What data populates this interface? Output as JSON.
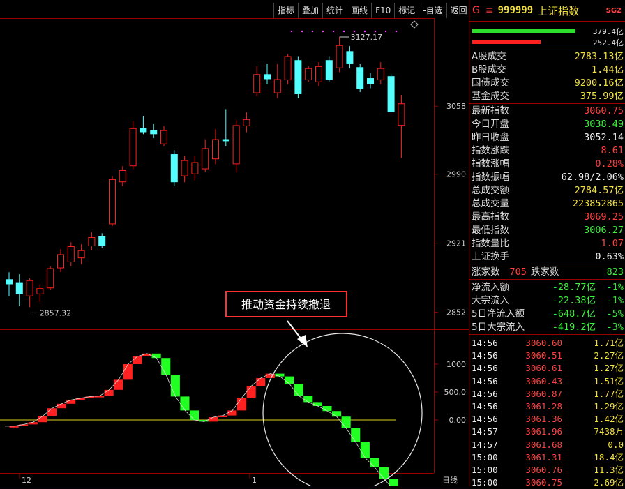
{
  "toolbar": [
    "指标",
    "叠加",
    "统计",
    "画线",
    "F10",
    "标记",
    "-自选",
    "返回"
  ],
  "header": {
    "prefix": "G",
    "menu_icon": "≡",
    "code": "999999",
    "name": "上证指数",
    "badge": "SG2"
  },
  "volume_bars": {
    "up_value": "379.4亿",
    "down_value": "252.4亿"
  },
  "stats1": [
    {
      "label": "A股成交",
      "value": "2783.13亿",
      "color": "yellow"
    },
    {
      "label": "B股成交",
      "value": "1.44亿",
      "color": "yellow"
    },
    {
      "label": "国债成交",
      "value": "9200.16亿",
      "color": "yellow"
    },
    {
      "label": "基金成交",
      "value": "375.99亿",
      "color": "yellow"
    }
  ],
  "stats2": [
    {
      "label": "最新指数",
      "value": "3060.75",
      "color": "red"
    },
    {
      "label": "今日开盘",
      "value": "3038.49",
      "color": "green"
    },
    {
      "label": "昨日收盘",
      "value": "3052.14",
      "color": "white"
    },
    {
      "label": "指数涨跌",
      "value": "8.61",
      "color": "red"
    },
    {
      "label": "指数涨幅",
      "value": "0.28%",
      "color": "red"
    },
    {
      "label": "指数振幅",
      "value": "62.98/2.06%",
      "color": "white"
    },
    {
      "label": "总成交额",
      "value": "2784.57亿",
      "color": "yellow"
    },
    {
      "label": "总成交量",
      "value": "223852865",
      "color": "yellow"
    },
    {
      "label": "最高指数",
      "value": "3069.25",
      "color": "red"
    },
    {
      "label": "最低指数",
      "value": "3006.27",
      "color": "green"
    },
    {
      "label": "指数量比",
      "value": "1.07",
      "color": "red"
    },
    {
      "label": "上证换手",
      "value": "0.63%",
      "color": "white"
    }
  ],
  "updown": {
    "up_label": "涨家数",
    "up_value": "705",
    "down_label": "跌家数",
    "down_value": "823"
  },
  "flows": [
    {
      "label": "净流入额",
      "value": "-28.77亿",
      "pct": "-1%"
    },
    {
      "label": "大宗流入",
      "value": "-22.38亿",
      "pct": "-1%"
    },
    {
      "label": "5日净流入额",
      "value": "-648.7亿",
      "pct": "-5%"
    },
    {
      "label": "5日大宗流入",
      "value": "-419.2亿",
      "pct": "-3%"
    }
  ],
  "ticks": [
    {
      "time": "14:56",
      "price": "3060.60",
      "vol": "1.71亿"
    },
    {
      "time": "14:56",
      "price": "3060.51",
      "vol": "2.27亿"
    },
    {
      "time": "14:56",
      "price": "3060.61",
      "vol": "1.27亿"
    },
    {
      "time": "14:56",
      "price": "3060.43",
      "vol": "1.51亿"
    },
    {
      "time": "14:56",
      "price": "3060.87",
      "vol": "1.77亿"
    },
    {
      "time": "14:56",
      "price": "3061.28",
      "vol": "1.29亿"
    },
    {
      "time": "14:56",
      "price": "3061.36",
      "vol": "1.42亿"
    },
    {
      "time": "14:57",
      "price": "3061.96",
      "vol": "7438万"
    },
    {
      "time": "14:57",
      "price": "3061.68",
      "vol": "0.0"
    },
    {
      "time": "15:00",
      "price": "3061.31",
      "vol": "18.4亿"
    },
    {
      "time": "15:00",
      "price": "3060.76",
      "vol": "11.3亿"
    },
    {
      "time": "15:00",
      "price": "3060.75",
      "vol": "2.69亿"
    }
  ],
  "chart_data": {
    "type": "candlestick",
    "price_axis_ticks": [
      "3058",
      "2990",
      "2921",
      "2852"
    ],
    "high_label": "3127.17",
    "low_label": "2857.32",
    "indicator_axis_ticks": [
      "1000",
      "500.0",
      "0.00"
    ],
    "x_labels": [
      "12",
      "1"
    ],
    "period_label": "日线",
    "annotation": "推动资金持续撤退",
    "candles": [
      {
        "o": 2885,
        "h": 2892,
        "l": 2868,
        "c": 2880
      },
      {
        "o": 2882,
        "h": 2890,
        "l": 2858,
        "c": 2870
      },
      {
        "o": 2868,
        "h": 2886,
        "l": 2857,
        "c": 2884
      },
      {
        "o": 2870,
        "h": 2880,
        "l": 2862,
        "c": 2876
      },
      {
        "o": 2876,
        "h": 2898,
        "l": 2874,
        "c": 2896
      },
      {
        "o": 2896,
        "h": 2915,
        "l": 2892,
        "c": 2910
      },
      {
        "o": 2902,
        "h": 2922,
        "l": 2898,
        "c": 2918
      },
      {
        "o": 2906,
        "h": 2920,
        "l": 2900,
        "c": 2914
      },
      {
        "o": 2918,
        "h": 2932,
        "l": 2914,
        "c": 2927
      },
      {
        "o": 2928,
        "h": 2931,
        "l": 2916,
        "c": 2918
      },
      {
        "o": 2940,
        "h": 2988,
        "l": 2938,
        "c": 2985
      },
      {
        "o": 2982,
        "h": 2998,
        "l": 2978,
        "c": 2994
      },
      {
        "o": 2998,
        "h": 3043,
        "l": 2995,
        "c": 3036
      },
      {
        "o": 3036,
        "h": 3048,
        "l": 3030,
        "c": 3032
      },
      {
        "o": 3034,
        "h": 3040,
        "l": 3026,
        "c": 3030
      },
      {
        "o": 3020,
        "h": 3038,
        "l": 3018,
        "c": 3034
      },
      {
        "o": 3010,
        "h": 3014,
        "l": 2978,
        "c": 2982
      },
      {
        "o": 2988,
        "h": 3008,
        "l": 2982,
        "c": 3004
      },
      {
        "o": 2990,
        "h": 3008,
        "l": 2984,
        "c": 3002
      },
      {
        "o": 2995,
        "h": 3025,
        "l": 2992,
        "c": 3016
      },
      {
        "o": 3005,
        "h": 3035,
        "l": 3000,
        "c": 3025
      },
      {
        "o": 3025,
        "h": 3055,
        "l": 3018,
        "c": 3023
      },
      {
        "o": 3000,
        "h": 3044,
        "l": 2992,
        "c": 3039
      },
      {
        "o": 3038,
        "h": 3052,
        "l": 3032,
        "c": 3045
      },
      {
        "o": 3071,
        "h": 3098,
        "l": 3068,
        "c": 3090
      },
      {
        "o": 3090,
        "h": 3100,
        "l": 3080,
        "c": 3085
      },
      {
        "o": 3071,
        "h": 3100,
        "l": 3066,
        "c": 3085
      },
      {
        "o": 3084,
        "h": 3110,
        "l": 3080,
        "c": 3108
      },
      {
        "o": 3104,
        "h": 3108,
        "l": 3066,
        "c": 3070
      },
      {
        "o": 3084,
        "h": 3098,
        "l": 3082,
        "c": 3096
      },
      {
        "o": 3082,
        "h": 3102,
        "l": 3078,
        "c": 3098
      },
      {
        "o": 3104,
        "h": 3108,
        "l": 3082,
        "c": 3084
      },
      {
        "o": 3096,
        "h": 3127.17,
        "l": 3092,
        "c": 3119
      },
      {
        "o": 3113,
        "h": 3118,
        "l": 3096,
        "c": 3100
      },
      {
        "o": 3097,
        "h": 3100,
        "l": 3072,
        "c": 3075
      },
      {
        "o": 3086,
        "h": 3091,
        "l": 3076,
        "c": 3080
      },
      {
        "o": 3084,
        "h": 3102,
        "l": 3080,
        "c": 3096
      },
      {
        "o": 3088,
        "h": 3090,
        "l": 3054,
        "c": 3052
      },
      {
        "o": 3038.49,
        "h": 3069.25,
        "l": 3006.27,
        "c": 3060.75
      }
    ],
    "indicator": [
      -110,
      -110,
      -80,
      -40,
      70,
      210,
      290,
      360,
      390,
      420,
      430,
      540,
      720,
      1000,
      1140,
      1190,
      1110,
      810,
      420,
      170,
      0,
      -30,
      50,
      80,
      170,
      400,
      610,
      750,
      830,
      780,
      650,
      430,
      320,
      250,
      160,
      60,
      -150,
      -400,
      -680,
      -850,
      -1060,
      -1250
    ]
  }
}
